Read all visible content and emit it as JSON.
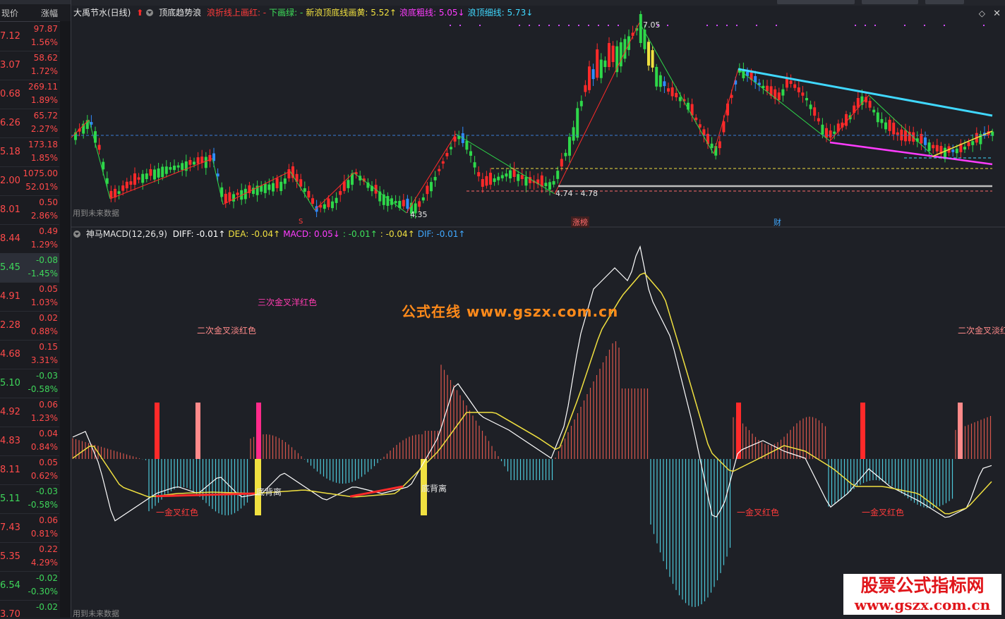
{
  "quote_panel": {
    "header_price": "现价",
    "header_change": "涨幅",
    "rows": [
      {
        "price": "7.12",
        "value": "97.87",
        "pct": "1.56%",
        "dir": "up"
      },
      {
        "price": "3.07",
        "value": "58.62",
        "pct": "1.72%",
        "dir": "up"
      },
      {
        "price": "0.68",
        "value": "269.11",
        "pct": "1.89%",
        "dir": "up"
      },
      {
        "price": "6.26",
        "value": "65.72",
        "pct": "2.27%",
        "dir": "up"
      },
      {
        "price": "5.18",
        "value": "173.18",
        "pct": "1.85%",
        "dir": "up"
      },
      {
        "price": "2.00",
        "value": "1075.00",
        "pct": "52.01%",
        "dir": "up"
      },
      {
        "price": "8.01",
        "value": "0.50",
        "pct": "2.86%",
        "dir": "up"
      },
      {
        "price": "8.44",
        "value": "0.49",
        "pct": "1.29%",
        "dir": "up"
      },
      {
        "price": "5.45",
        "value": "-0.08",
        "pct": "-1.45%",
        "dir": "down"
      },
      {
        "price": "4.91",
        "value": "0.05",
        "pct": "1.03%",
        "dir": "up"
      },
      {
        "price": "2.28",
        "value": "0.02",
        "pct": "0.88%",
        "dir": "up"
      },
      {
        "price": "4.68",
        "value": "0.15",
        "pct": "3.31%",
        "dir": "up"
      },
      {
        "price": "5.10",
        "value": "-0.03",
        "pct": "-0.58%",
        "dir": "down"
      },
      {
        "price": "4.92",
        "value": "0.06",
        "pct": "1.23%",
        "dir": "up"
      },
      {
        "price": "4.83",
        "value": "0.04",
        "pct": "0.84%",
        "dir": "up"
      },
      {
        "price": "8.11",
        "value": "0.05",
        "pct": "0.62%",
        "dir": "up"
      },
      {
        "price": "5.11",
        "value": "-0.03",
        "pct": "-0.58%",
        "dir": "down"
      },
      {
        "price": "7.43",
        "value": "0.06",
        "pct": "0.81%",
        "dir": "up"
      },
      {
        "price": "5.35",
        "value": "0.22",
        "pct": "4.29%",
        "dir": "up"
      },
      {
        "price": "6.54",
        "value": "-0.02",
        "pct": "-0.30%",
        "dir": "down"
      },
      {
        "price": "3.70",
        "value": "-0.02",
        "pct": "",
        "dir": "down"
      }
    ]
  },
  "main_chart": {
    "title": "大禹节水(日线)",
    "indicator_name": "顶底趋势浪",
    "legend": [
      {
        "text": "浪折线上画红: -",
        "color": "#ff3b3b"
      },
      {
        "text": "下画绿: -",
        "color": "#3ee05a"
      },
      {
        "text": "新浪顶底线画黄: 5.52↑",
        "color": "#f0e040"
      },
      {
        "text": "浪底粗线: 5.05↓",
        "color": "#ff3cff"
      },
      {
        "text": "浪顶细线: 5.73↓",
        "color": "#40d8ff"
      }
    ],
    "watermark": "用到未来数据",
    "peak_label": "7.05",
    "low_label": "4.35",
    "range_label": "4.74 - 4.78",
    "event_zhangbang": "涨榜",
    "event_cai": "财",
    "event_s": "S"
  },
  "macd_panel": {
    "name": "神马MACD(12,26,9)",
    "legend": [
      {
        "text": "DIFF: -0.01↑",
        "color": "#ffffff"
      },
      {
        "text": "DEA: -0.04↑",
        "color": "#f0e040"
      },
      {
        "text": "MACD: 0.05↓",
        "color": "#ff3cff"
      },
      {
        "text": ": -0.01↑",
        "color": "#3ee05a"
      },
      {
        "text": ": -0.04↑",
        "color": "#f0e040"
      },
      {
        "text": "DIF: -0.01↑",
        "color": "#40a8ff"
      }
    ],
    "annotations": {
      "triple_cross": "三次金叉洋红色",
      "double_cross_left": "二次金叉淡红色",
      "double_cross_right": "二次金叉淡红",
      "gold_cross_1": "一金叉红色",
      "gold_cross_2": "一金叉红色",
      "gold_cross_3": "一金叉红色",
      "divergence_1": "底背离",
      "divergence_2": "底背离"
    },
    "watermark": "用到未来数据"
  },
  "site_watermark": "公式在线 www.gszx.com.cn",
  "logo": {
    "line1": "股票公式指标网",
    "line2": "www.gszx.com.cn"
  },
  "colors": {
    "bg": "#1e2026",
    "up": "#ff2a2a",
    "down": "#2ed84a",
    "blue": "#2f8cff",
    "yellow": "#f0e040",
    "cyan": "#40d8ff",
    "magenta": "#ff3cff",
    "white": "#ffffff"
  }
}
